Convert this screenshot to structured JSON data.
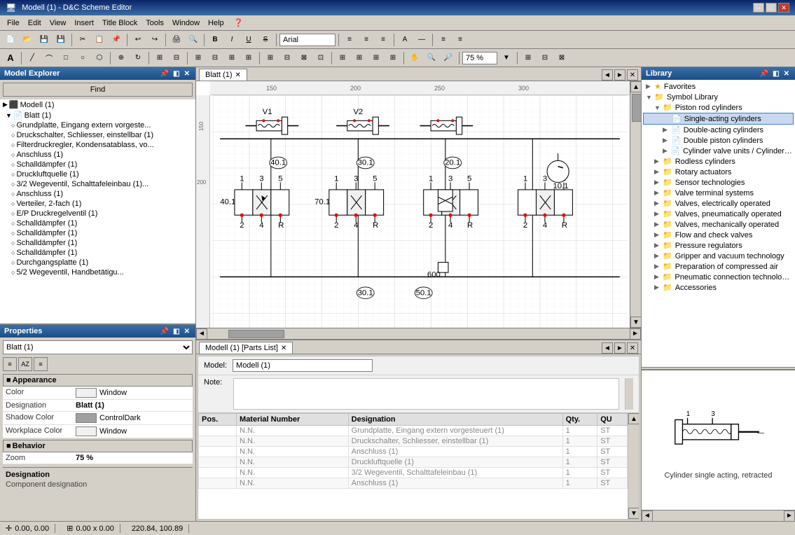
{
  "title_bar": {
    "text": "Modell (1) - D&C Scheme Editor",
    "buttons": [
      "_",
      "□",
      "✕"
    ]
  },
  "menu": {
    "items": [
      "File",
      "Edit",
      "View",
      "Insert",
      "Title Block",
      "Tools",
      "Window",
      "Help"
    ]
  },
  "model_explorer": {
    "title": "Model Explorer",
    "find_btn": "Find",
    "tree": [
      {
        "label": "Modell (1)",
        "level": 0,
        "icon": "▶",
        "type": "root"
      },
      {
        "label": "Blatt (1)",
        "level": 1,
        "icon": "▶",
        "type": "sheet"
      },
      {
        "label": "Grundplatte, Eingang extern vorgeste...",
        "level": 2,
        "icon": "○",
        "type": "item"
      },
      {
        "label": "Druckschalter, Schliesser, einstellbar (1)",
        "level": 2,
        "icon": "○",
        "type": "item"
      },
      {
        "label": "Filterdruckregler, Kondensatablass, vo...",
        "level": 2,
        "icon": "○",
        "type": "item"
      },
      {
        "label": "Anschluss (1)",
        "level": 2,
        "icon": "○",
        "type": "item"
      },
      {
        "label": "Schalldämpfer (1)",
        "level": 2,
        "icon": "○",
        "type": "item"
      },
      {
        "label": "Druckluftquelle (1)",
        "level": 2,
        "icon": "○",
        "type": "item"
      },
      {
        "label": "3/2 Wegeventil, Schalttafeleinbau (1)...",
        "level": 2,
        "icon": "○",
        "type": "item"
      },
      {
        "label": "Anschluss (1)",
        "level": 2,
        "icon": "○",
        "type": "item"
      },
      {
        "label": "Verteiler, 2-fach (1)",
        "level": 2,
        "icon": "○",
        "type": "item"
      },
      {
        "label": "E/P Druckregelventil (1)",
        "level": 2,
        "icon": "○",
        "type": "item"
      },
      {
        "label": "Schalldämpfer (1)",
        "level": 2,
        "icon": "○",
        "type": "item"
      },
      {
        "label": "Schalldämpfer (1)",
        "level": 2,
        "icon": "○",
        "type": "item"
      },
      {
        "label": "Schalldämpfer (1)",
        "level": 2,
        "icon": "○",
        "type": "item"
      },
      {
        "label": "Schalldämpfer (1)",
        "level": 2,
        "icon": "○",
        "type": "item"
      },
      {
        "label": "Durchgangsplatte (1)",
        "level": 2,
        "icon": "○",
        "type": "item"
      },
      {
        "label": "5/2 Wegeventil, Handbetätigu...",
        "level": 2,
        "icon": "○",
        "type": "item"
      }
    ]
  },
  "properties": {
    "title": "Properties",
    "selected": "Blatt (1)",
    "sections": {
      "appearance": {
        "label": "Appearance",
        "rows": [
          {
            "label": "Color",
            "value": "Window",
            "type": "color"
          },
          {
            "label": "Designation",
            "value": "Blatt (1)",
            "type": "bold"
          },
          {
            "label": "Shadow Color",
            "value": "ControlDark",
            "type": "color"
          },
          {
            "label": "Workplace Color",
            "value": "Window",
            "type": "color"
          }
        ]
      },
      "behavior": {
        "label": "Behavior",
        "rows": [
          {
            "label": "Zoom",
            "value": "75 %",
            "type": "bold"
          }
        ]
      }
    },
    "description": {
      "title": "Designation",
      "text": "Component designation"
    }
  },
  "drawing": {
    "tab": "Blatt (1)",
    "rulers": {
      "h_marks": [
        "150",
        "200",
        "250",
        "300"
      ],
      "v_marks": [
        "150",
        "200"
      ]
    }
  },
  "parts_list": {
    "tab": "Modell (1) [Parts List]",
    "model_label": "Model:",
    "model_value": "Modell (1)",
    "note_label": "Note:",
    "columns": [
      "Pos.",
      "Material Number",
      "Designation",
      "Qty.",
      "QU"
    ],
    "rows": [
      {
        "pos": "",
        "mat": "N.N.",
        "desc": "Grundplatte, Eingang extern vorgesteuert (1)",
        "qty": "1",
        "qu": "ST"
      },
      {
        "pos": "",
        "mat": "N.N.",
        "desc": "Druckschalter, Schliesser, einstellbar (1)",
        "qty": "1",
        "qu": "ST"
      },
      {
        "pos": "",
        "mat": "N.N.",
        "desc": "Anschluss (1)",
        "qty": "1",
        "qu": "ST"
      },
      {
        "pos": "",
        "mat": "N.N.",
        "desc": "Druckluftquelle (1)",
        "qty": "1",
        "qu": "ST"
      },
      {
        "pos": "",
        "mat": "N.N.",
        "desc": "3/2 Wegeventil, Schalttafeleinbau (1)",
        "qty": "1",
        "qu": "ST"
      },
      {
        "pos": "",
        "mat": "N.N.",
        "desc": "Anschluss (1)",
        "qty": "1",
        "qu": "ST"
      }
    ]
  },
  "library": {
    "title": "Library",
    "tree": [
      {
        "label": "Favorites",
        "level": 0,
        "icon": "★",
        "expand": "▶"
      },
      {
        "label": "Symbol Library",
        "level": 0,
        "icon": "📁",
        "expand": "▼"
      },
      {
        "label": "Piston rod cylinders",
        "level": 1,
        "icon": "📁",
        "expand": "▼"
      },
      {
        "label": "Single-acting cylinders",
        "level": 2,
        "icon": "📄",
        "expand": "",
        "selected": true
      },
      {
        "label": "Double-acting cylinders",
        "level": 2,
        "icon": "📄",
        "expand": "▶"
      },
      {
        "label": "Double piston cylinders",
        "level": 2,
        "icon": "📄",
        "expand": "▶"
      },
      {
        "label": "Cylinder valve units / Cylinder se...",
        "level": 2,
        "icon": "📄",
        "expand": "▶"
      },
      {
        "label": "Rodless cylinders",
        "level": 1,
        "icon": "📁",
        "expand": "▶"
      },
      {
        "label": "Rotary actuators",
        "level": 1,
        "icon": "📁",
        "expand": "▶"
      },
      {
        "label": "Sensor technologies",
        "level": 1,
        "icon": "📁",
        "expand": "▶"
      },
      {
        "label": "Valve terminal systems",
        "level": 1,
        "icon": "📁",
        "expand": "▶"
      },
      {
        "label": "Valves, electrically operated",
        "level": 1,
        "icon": "📁",
        "expand": "▶"
      },
      {
        "label": "Valves, pneumatically operated",
        "level": 1,
        "icon": "📁",
        "expand": "▶"
      },
      {
        "label": "Valves, mechanically operated",
        "level": 1,
        "icon": "📁",
        "expand": "▶"
      },
      {
        "label": "Flow and check valves",
        "level": 1,
        "icon": "📁",
        "expand": "▶"
      },
      {
        "label": "Pressure regulators",
        "level": 1,
        "icon": "📁",
        "expand": "▶"
      },
      {
        "label": "Gripper and vacuum technology",
        "level": 1,
        "icon": "📁",
        "expand": "▶"
      },
      {
        "label": "Preparation of compressed air",
        "level": 1,
        "icon": "📁",
        "expand": "▶"
      },
      {
        "label": "Pneumatic connection technologies",
        "level": 1,
        "icon": "📁",
        "expand": "▶"
      },
      {
        "label": "Accessories",
        "level": 1,
        "icon": "📁",
        "expand": "▶"
      }
    ],
    "preview_label": "Cylinder single acting, retracted"
  },
  "status_bar": {
    "coords": "0.00, 0.00",
    "size": "0.00 x 0.00",
    "pos": "220.84, 100.89"
  },
  "icons": {
    "arrow_left": "◄",
    "arrow_right": "►",
    "arrow_up": "▲",
    "arrow_down": "▼",
    "close": "✕",
    "minimize": "–",
    "maximize": "□",
    "pin": "📌",
    "expand": "▶",
    "collapse": "▼",
    "minus_box": "■"
  }
}
